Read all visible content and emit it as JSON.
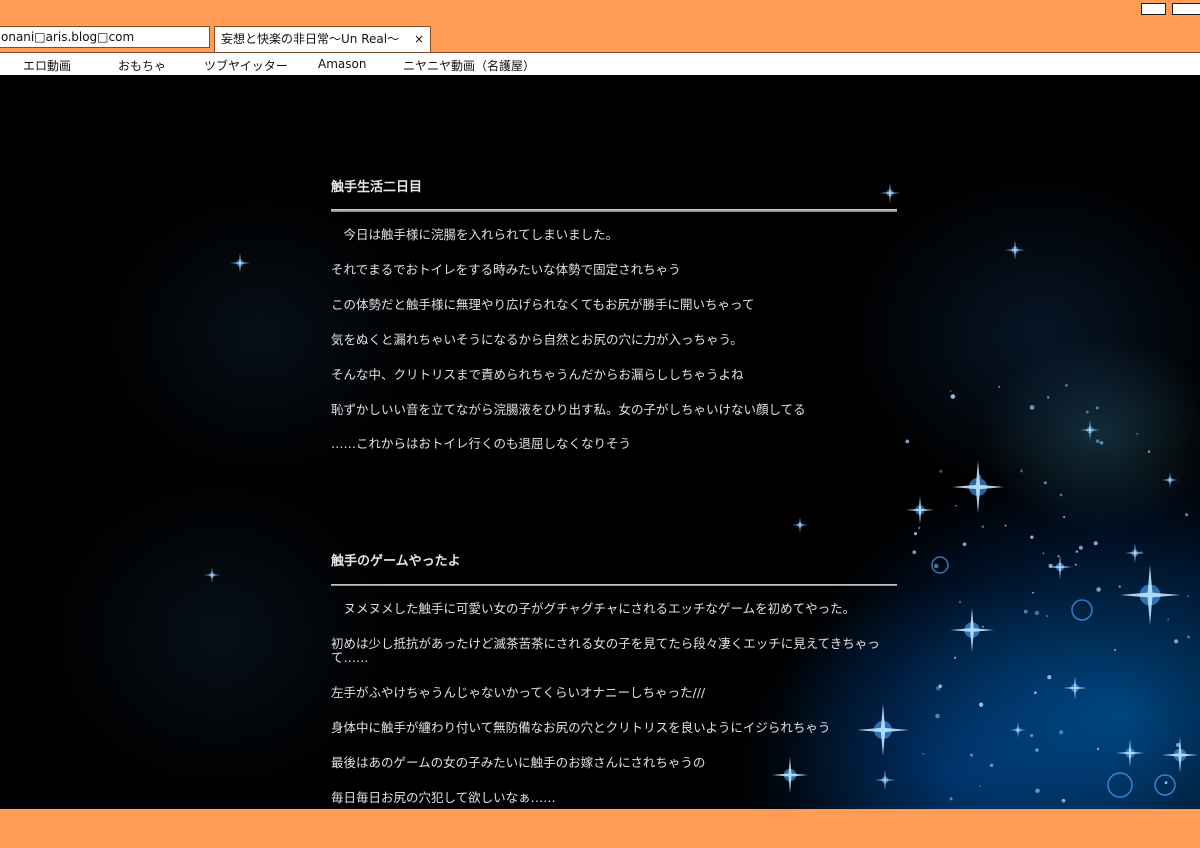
{
  "browser": {
    "address": "onani□aris.blog□com",
    "tab_title": "妄想と快楽の非日常～Un Real～",
    "tab_close": "×"
  },
  "bookmarks": [
    "エロ動画",
    "おもちゃ",
    "ツブヤイッター",
    "Amason",
    "ニヤニヤ動画（名護屋）"
  ],
  "posts": [
    {
      "title": "触手生活二日目",
      "lines": [
        "　今日は触手様に浣腸を入れられてしまいました。",
        "それでまるでおトイレをする時みたいな体勢で固定されちゃう",
        "この体勢だと触手様に無理やり広げられなくてもお尻が勝手に開いちゃって",
        "気をぬくと漏れちゃいそうになるから自然とお尻の穴に力が入っちゃう。",
        "そんな中、クリトリスまで責められちゃうんだからお漏らししちゃうよね",
        "恥ずかしいい音を立てながら浣腸液をひり出す私。女の子がしちゃいけない顔してる",
        "……これからはおトイレ行くのも退屈しなくなりそう"
      ]
    },
    {
      "title": "触手のゲームやったよ",
      "lines": [
        "　ヌメヌメした触手に可愛い女の子がグチャグチャにされるエッチなゲームを初めてやった。",
        "初めは少し抵抗があったけど滅茶苦茶にされる女の子を見てたら段々凄くエッチに見えてきちゃって……",
        "左手がふやけちゃうんじゃないかってくらいオナニーしちゃった///",
        "身体中に触手が纏わり付いて無防備なお尻の穴とクリトリスを良いようにイジられちゃう",
        "最後はあのゲームの女の子みたいに触手のお嫁さんにされちゃうの",
        "毎日毎日お尻の穴犯して欲しいなぁ……"
      ]
    }
  ],
  "colors": {
    "chrome": "#ff9c55",
    "page_background": "#000000",
    "text": "#e0e0e0",
    "sparkle": "#4aa8ff"
  }
}
